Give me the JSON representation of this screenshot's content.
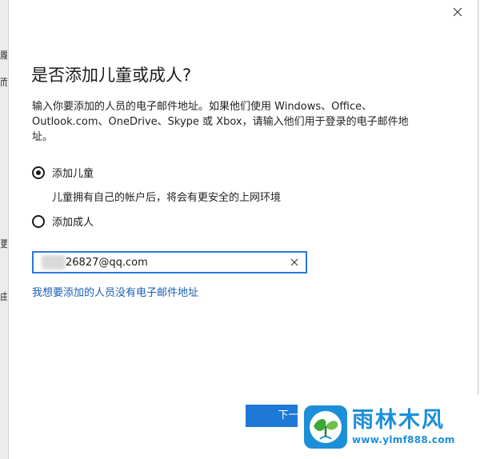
{
  "background": {
    "fragments": [
      "龎",
      "而",
      "更",
      "由"
    ]
  },
  "dialog": {
    "title": "是否添加儿童或成人?",
    "description": "输入你要添加的人员的电子邮件地址。如果他们使用 Windows、Office、Outlook.com、OneDrive、Skype 或 Xbox，请输入他们用于登录的电子邮件地址。",
    "options": [
      {
        "label": "添加儿童",
        "checked": true
      },
      {
        "label": "添加成人",
        "checked": false
      }
    ],
    "child_description": "儿童拥有自己的帐户后，将会有更安全的上网环境",
    "email": {
      "value": "26827@qq.com"
    },
    "no_email_link": "我想要添加的人员没有电子邮件地址",
    "next_button": "下一步",
    "close_icon": "close-icon",
    "clear_icon": "clear-icon"
  },
  "watermark": {
    "title": "雨林木风",
    "url": "www.ylmf888.com"
  },
  "colors": {
    "accent": "#1e79d6",
    "link": "#1a5fb4",
    "watermark": "#1b8fd8"
  }
}
